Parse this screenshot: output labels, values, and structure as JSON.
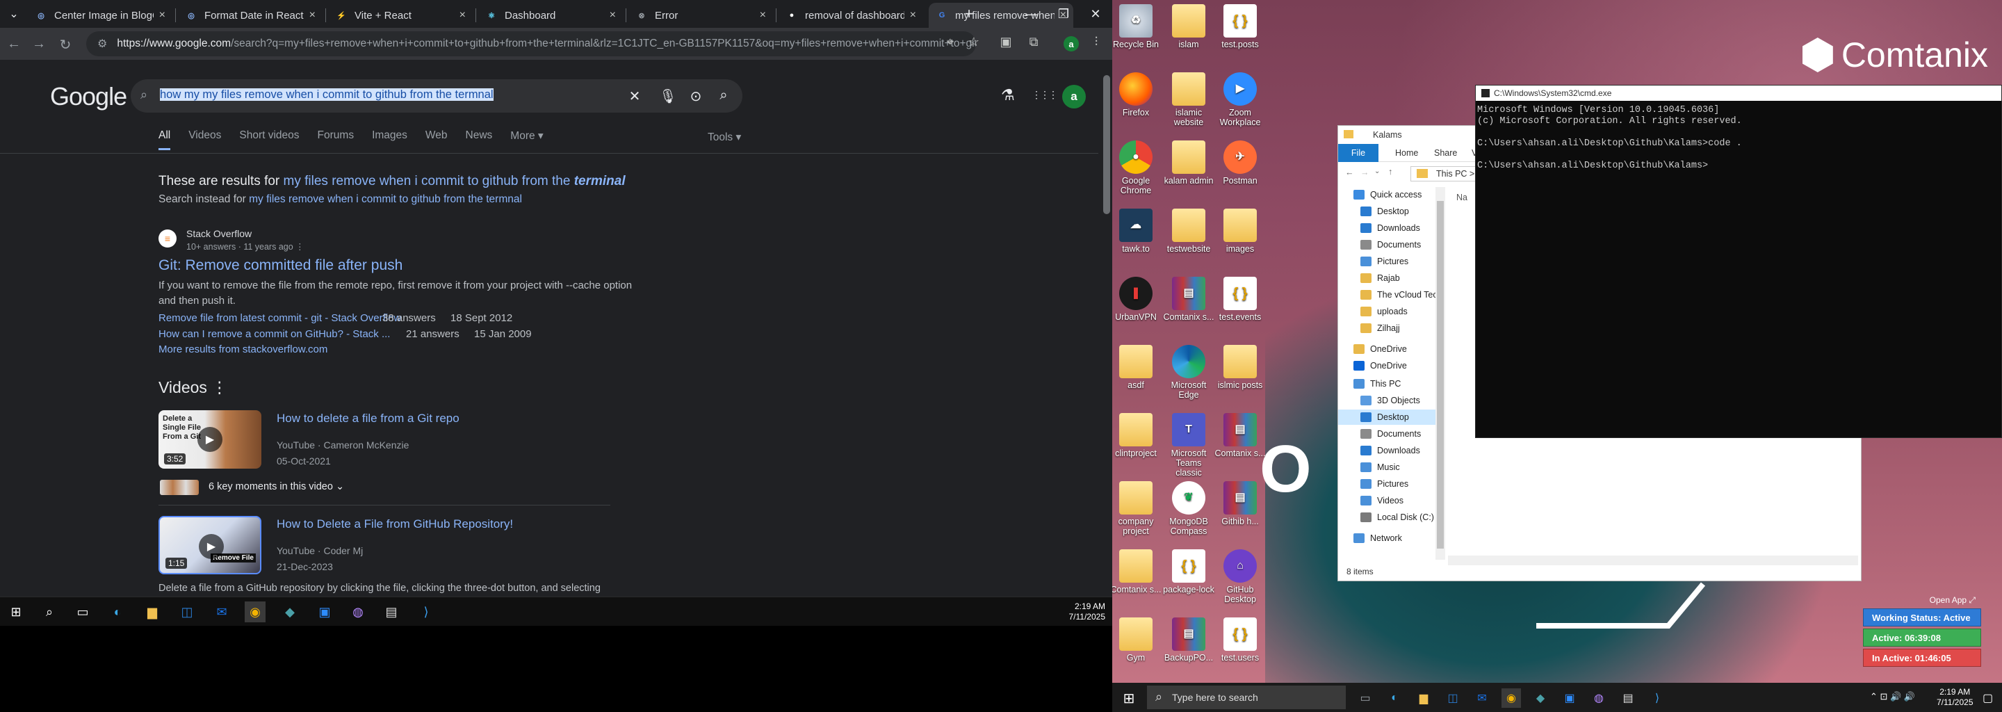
{
  "browser": {
    "tabs": [
      {
        "title": "Center Image in BlogC",
        "color": "#8ab4f8",
        "glyph": "◎"
      },
      {
        "title": "Format Date in React C",
        "color": "#8ab4f8",
        "glyph": "◎"
      },
      {
        "title": "Vite + React",
        "color": "#a259ff",
        "glyph": "⚡"
      },
      {
        "title": "Dashboard",
        "color": "#61dafb",
        "glyph": "⚛"
      },
      {
        "title": "Error",
        "color": "#9aa0a6",
        "glyph": "⊗"
      },
      {
        "title": "removal of dashboard",
        "color": "#ffffff",
        "glyph": "●"
      },
      {
        "title": "my files remove when",
        "color": "#4285f4",
        "glyph": "G"
      }
    ],
    "close_glyph": "×",
    "new_tab_glyph": "+",
    "tab_list_glyph": "⌄",
    "window": {
      "minimize": "—",
      "maximize": "❐",
      "close": "✕"
    },
    "nav": {
      "back": "←",
      "forward": "→",
      "reload": "↻"
    },
    "url_domain": "https://www.google.com",
    "url_rest": "/search?q=my+files+remove+when+i+commit+to+github+from+the+terminal&rlz=1C1JTC_en-GB1157PK1157&oq=my+files+remove+when+i+commit+to+gith...",
    "tune_glyph": "⚙",
    "toolbar_icons": [
      "⌖",
      "☆",
      "▣",
      "⧉",
      "⫶"
    ],
    "avatar_letter": "a"
  },
  "google": {
    "logo": "Google",
    "query": "how my my files remove when i commit to github from the termnal",
    "search_icons": {
      "mag": "⌕",
      "clear": "✕",
      "mic": "🎙",
      "lens": "⊙",
      "search": "⌕"
    },
    "header_icons": {
      "labs": "⚗",
      "apps": "⋮⋮⋮"
    },
    "tabs": [
      "All",
      "Videos",
      "Short videos",
      "Forums",
      "Images",
      "Web",
      "News",
      "More ▾"
    ],
    "tools": "Tools ▾",
    "correction_prefix": "These are results for ",
    "correction_link": "my files remove when i commit to github from the ",
    "correction_em": "terminal",
    "instead_prefix": "Search instead for ",
    "instead_link": "my files remove when i commit to github from the termnal",
    "result": {
      "site": "Stack Overflow",
      "meta": "10+ answers · 11 years ago  ⋮",
      "title": "Git: Remove committed file after push",
      "snippet_line1": "If you want to remove the file from the remote repo, first remove it from your project with --cache option",
      "snippet_line2": "and then push it.",
      "sub": [
        {
          "title": "Remove file from latest commit - git - Stack Overflow",
          "answers": "38 answers",
          "date": "18 Sept 2012"
        },
        {
          "title": "How can I remove a commit on GitHub? - Stack ...",
          "answers": "21 answers",
          "date": "15 Jan 2009"
        }
      ],
      "more": "More results from stackoverflow.com"
    },
    "videos_heading": "Videos  ⋮",
    "videos": [
      {
        "title": "How to delete a file from a Git repo",
        "source": "YouTube · Cameron McKenzie",
        "date": "05-Oct-2021",
        "duration": "3:52",
        "thumb_text": "Delete a Single File From a Git"
      },
      {
        "title": "How to Delete a File from GitHub Repository!",
        "source": "YouTube · Coder Mj",
        "date": "21-Dec-2023",
        "duration": "1:15",
        "thumb_text": "Remove File"
      }
    ],
    "key_moments": "6 key moments in this video  ⌄",
    "bottom_snippet": "Delete a file from a GitHub repository by clicking the file, clicking the three-dot button, and selecting"
  },
  "taskbar_left": {
    "time": "2:19 AM",
    "date": "7/11/2025"
  },
  "desktop": {
    "brand": "Comtanix",
    "wallpaper_text": "O P",
    "icons": [
      {
        "label": "Recycle Bin",
        "kind": "bin"
      },
      {
        "label": "islam",
        "kind": "folder"
      },
      {
        "label": "test.posts",
        "kind": "file"
      },
      {
        "label": "Firefox",
        "kind": "firefox"
      },
      {
        "label": "islamic website",
        "kind": "folder"
      },
      {
        "label": "Zoom Workplace",
        "kind": "zoom"
      },
      {
        "label": "Google Chrome",
        "kind": "chrome"
      },
      {
        "label": "kalam admin",
        "kind": "folder"
      },
      {
        "label": "Postman",
        "kind": "postman"
      },
      {
        "label": "tawk.to",
        "kind": "tawk"
      },
      {
        "label": "testwebsite",
        "kind": "folder"
      },
      {
        "label": "images",
        "kind": "folder"
      },
      {
        "label": "UrbanVPN",
        "kind": "vpn"
      },
      {
        "label": "Comtanix s...",
        "kind": "rar"
      },
      {
        "label": "test.events",
        "kind": "file"
      },
      {
        "label": "asdf",
        "kind": "folder"
      },
      {
        "label": "Microsoft Edge",
        "kind": "edge"
      },
      {
        "label": "islmic posts",
        "kind": "folder"
      },
      {
        "label": "clintproject",
        "kind": "folder"
      },
      {
        "label": "Microsoft Teams classic",
        "kind": "teams"
      },
      {
        "label": "Comtanix s...",
        "kind": "rar"
      },
      {
        "label": "company project",
        "kind": "folder"
      },
      {
        "label": "MongoDB Compass",
        "kind": "mongo"
      },
      {
        "label": "Githib h...",
        "kind": "rar"
      },
      {
        "label": "Comtanix s...",
        "kind": "folder"
      },
      {
        "label": "package-lock",
        "kind": "file"
      },
      {
        "label": "GitHub Desktop",
        "kind": "github"
      },
      {
        "label": "Gym",
        "kind": "folder"
      },
      {
        "label": "BackupPO...",
        "kind": "rar"
      },
      {
        "label": "test.users",
        "kind": "file"
      }
    ]
  },
  "cmd": {
    "title": "C:\\Windows\\System32\\cmd.exe",
    "lines": [
      "Microsoft Windows [Version 10.0.19045.6036]",
      "(c) Microsoft Corporation. All rights reserved.",
      "",
      "C:\\Users\\ahsan.ali\\Desktop\\Github\\Kalams>code .",
      "",
      "C:\\Users\\ahsan.ali\\Desktop\\Github\\Kalams>"
    ]
  },
  "explorer": {
    "title": "Kalams",
    "ribbon": [
      "File",
      "Home",
      "Share",
      "Vie"
    ],
    "path": "This PC  >",
    "nav_items": [
      {
        "label": "Quick access",
        "color": "#3b8be0"
      },
      {
        "label": "Desktop",
        "color": "#2a7bd0"
      },
      {
        "label": "Downloads",
        "color": "#2a7bd0"
      },
      {
        "label": "Documents",
        "color": "#8a8a8a"
      },
      {
        "label": "Pictures",
        "color": "#4a90d9"
      },
      {
        "label": "Rajab",
        "color": "#e8b84a"
      },
      {
        "label": "The vCloud Tech",
        "color": "#e8b84a"
      },
      {
        "label": "uploads",
        "color": "#e8b84a"
      },
      {
        "label": "Zilhajj",
        "color": "#e8b84a"
      },
      {
        "label": "OneDrive",
        "color": "#e8b84a"
      },
      {
        "label": "OneDrive",
        "color": "#0a64d6"
      },
      {
        "label": "This PC",
        "color": "#4a90d9"
      },
      {
        "label": "3D Objects",
        "color": "#5a9be0"
      },
      {
        "label": "Desktop",
        "color": "#2a7bd0"
      },
      {
        "label": "Documents",
        "color": "#8a8a8a"
      },
      {
        "label": "Downloads",
        "color": "#2a7bd0"
      },
      {
        "label": "Music",
        "color": "#4a90d9"
      },
      {
        "label": "Pictures",
        "color": "#4a90d9"
      },
      {
        "label": "Videos",
        "color": "#4a90d9"
      },
      {
        "label": "Local Disk (C:)",
        "color": "#7a7a7a"
      },
      {
        "label": "Network",
        "color": "#4a90d9"
      }
    ],
    "column_header": "Na",
    "status": "8 items"
  },
  "widget": {
    "open_app": "Open App ⤢",
    "status": "Working Status: Active",
    "active": "Active: 06:39:08",
    "inactive": "In Active: 01:46:05",
    "colors": {
      "status": "#2e7bd6",
      "active": "#3dae55",
      "inactive": "#e04a4a"
    }
  },
  "taskbar_right": {
    "search_placeholder": "Type here to search",
    "time": "2:19 AM",
    "date": "7/11/2025",
    "tray": "⌃  ⊡  🔊  🔊"
  }
}
